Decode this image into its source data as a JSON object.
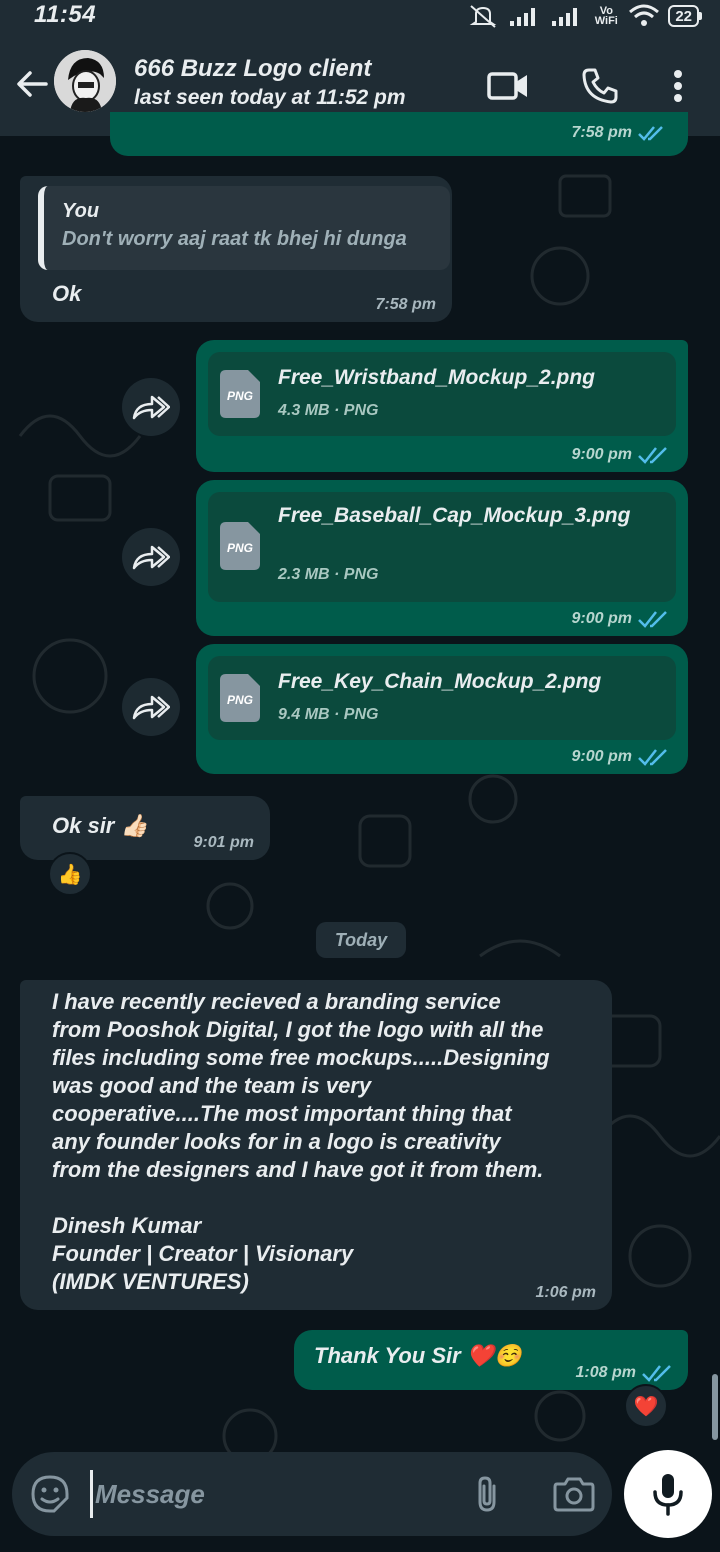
{
  "status_bar": {
    "time": "11:54",
    "wifi_label": "Vo WiFi",
    "battery": "22"
  },
  "header": {
    "contact_name": "666 Buzz Logo client",
    "last_seen": "last seen today at 11:52 pm",
    "icons": [
      "back-arrow-icon",
      "video-call-icon",
      "voice-call-icon",
      "more-options-icon"
    ]
  },
  "messages": {
    "partial_top": {
      "time": "7:58 pm"
    },
    "reply_msg": {
      "quote_author": "You",
      "quote_text": "Don't worry aaj raat tk bhej hi dunga",
      "text": "Ok",
      "time": "7:58 pm"
    },
    "files": [
      {
        "name": "Free_Wristband_Mockup_2.png",
        "info": "4.3 MB · PNG",
        "icon_label": "PNG",
        "time": "9:00 pm"
      },
      {
        "name": "Free_Baseball_Cap_Mockup_3.png",
        "info": "2.3 MB · PNG",
        "icon_label": "PNG",
        "time": "9:00 pm"
      },
      {
        "name": "Free_Key_Chain_Mockup_2.png",
        "info": "9.4 MB · PNG",
        "icon_label": "PNG",
        "time": "9:00 pm"
      }
    ],
    "ok_sir": {
      "text": "Ok sir 👍🏻",
      "time": "9:01 pm",
      "reaction": "👍"
    },
    "date_divider": "Today",
    "testimonial": {
      "lines": [
        "I have recently recieved a branding service",
        "from Pooshok Digital, I got the logo with all the",
        "files including some free mockups.....Designing",
        "was good and the team is very",
        "cooperative....The most important thing that",
        "any founder looks for in a logo is creativity",
        "from the designers and I have got it from them.",
        "",
        "Dinesh Kumar",
        "Founder | Creator | Visionary",
        "(IMDK VENTURES)"
      ],
      "time": "1:06 pm"
    },
    "thank_you": {
      "text": "Thank You Sir ❤️☺️",
      "time": "1:08 pm",
      "reaction": "❤️"
    }
  },
  "composer": {
    "placeholder": "Message",
    "value": ""
  },
  "colors": {
    "background": "#0b141a",
    "incoming_bubble": "#1f2c34",
    "outgoing_bubble": "#005c4b",
    "read_tick": "#53bdeb"
  }
}
